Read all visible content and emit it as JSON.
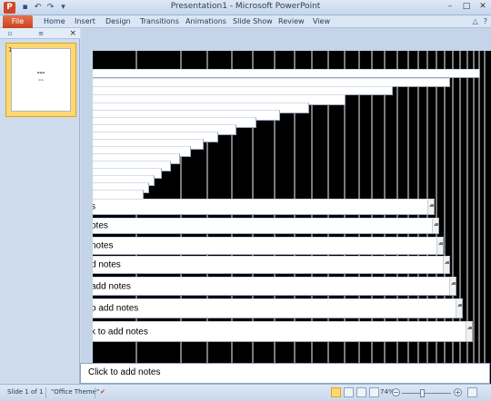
{
  "window": {
    "title": "Presentation1 - Microsoft PowerPoint",
    "app_icon": "P"
  },
  "quick_access": {
    "icons": [
      "save-icon",
      "undo-icon",
      "redo-icon",
      "customize-icon"
    ]
  },
  "ribbon": {
    "file_label": "File",
    "tabs": [
      "Home",
      "Insert",
      "Design",
      "Transitions",
      "Animations",
      "Slide Show",
      "Review",
      "View"
    ]
  },
  "slides_pane": {
    "slide_number": "1",
    "close_glyph": "×"
  },
  "notes": {
    "rows": [
      "s",
      "otes",
      "notes",
      "d notes",
      "add notes",
      "o add notes",
      "k to add notes"
    ],
    "placeholder": "Click to add notes"
  },
  "status": {
    "slide_info": "Slide 1 of 1",
    "theme": "\"Office Theme\"",
    "zoom": "74%",
    "zoom_level": 0.4
  },
  "colors": {
    "file_tab": "#c8431c",
    "accent": "#fbd874",
    "chrome": "#cfddee"
  }
}
